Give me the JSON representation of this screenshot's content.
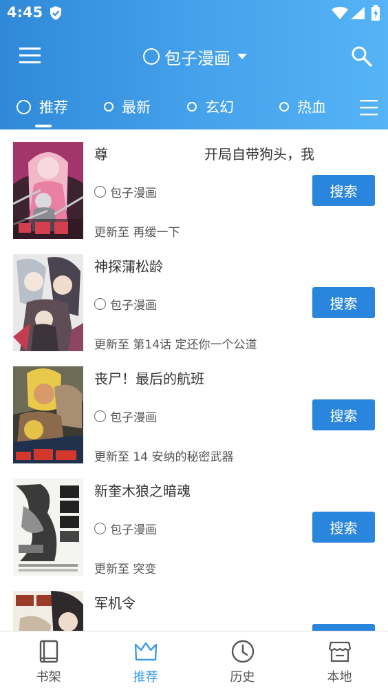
{
  "status_bar": {
    "time": "4:45",
    "icons": [
      "shield-check-icon",
      "wifi-icon",
      "signal-icon",
      "battery-icon"
    ]
  },
  "header": {
    "title": "包子漫画",
    "menu_icon": "hamburger-menu-icon",
    "title_icon": "circle-icon",
    "dropdown_icon": "caret-down-icon",
    "search_icon": "search-icon",
    "bg_colors": [
      "#2f89d8",
      "#55b3f6"
    ]
  },
  "tabs": [
    {
      "label": "推荐",
      "active": true
    },
    {
      "label": "最新",
      "active": false
    },
    {
      "label": "玄幻",
      "active": false
    },
    {
      "label": "热血",
      "active": false
    }
  ],
  "tabs_more_icon": "list-menu-icon",
  "books": [
    {
      "title": "尊　　　　　　　开局自带狗头，我",
      "source": "包子漫画",
      "update": "更新至 再缓一下",
      "action": "搜索"
    },
    {
      "title": "神探蒲松龄",
      "source": "包子漫画",
      "update": "更新至 第14话 定还你一个公道",
      "action": "搜索"
    },
    {
      "title": "丧尸！最后的航班",
      "source": "包子漫画",
      "update": "更新至 14 安纳的秘密武器",
      "action": "搜索"
    },
    {
      "title": "新奎木狼之暗魂",
      "source": "包子漫画",
      "update": "更新至 突变",
      "action": "搜索"
    },
    {
      "title": "军机令",
      "source": "",
      "update": "",
      "action": ""
    }
  ],
  "bottom_nav": [
    {
      "label": "书架",
      "icon": "book-icon",
      "active": false
    },
    {
      "label": "推荐",
      "icon": "crown-icon",
      "active": true
    },
    {
      "label": "历史",
      "icon": "clock-icon",
      "active": false
    },
    {
      "label": "本地",
      "icon": "store-icon",
      "active": false
    }
  ],
  "colors": {
    "accent": "#2a86dc",
    "active_nav": "#3a9bea"
  }
}
